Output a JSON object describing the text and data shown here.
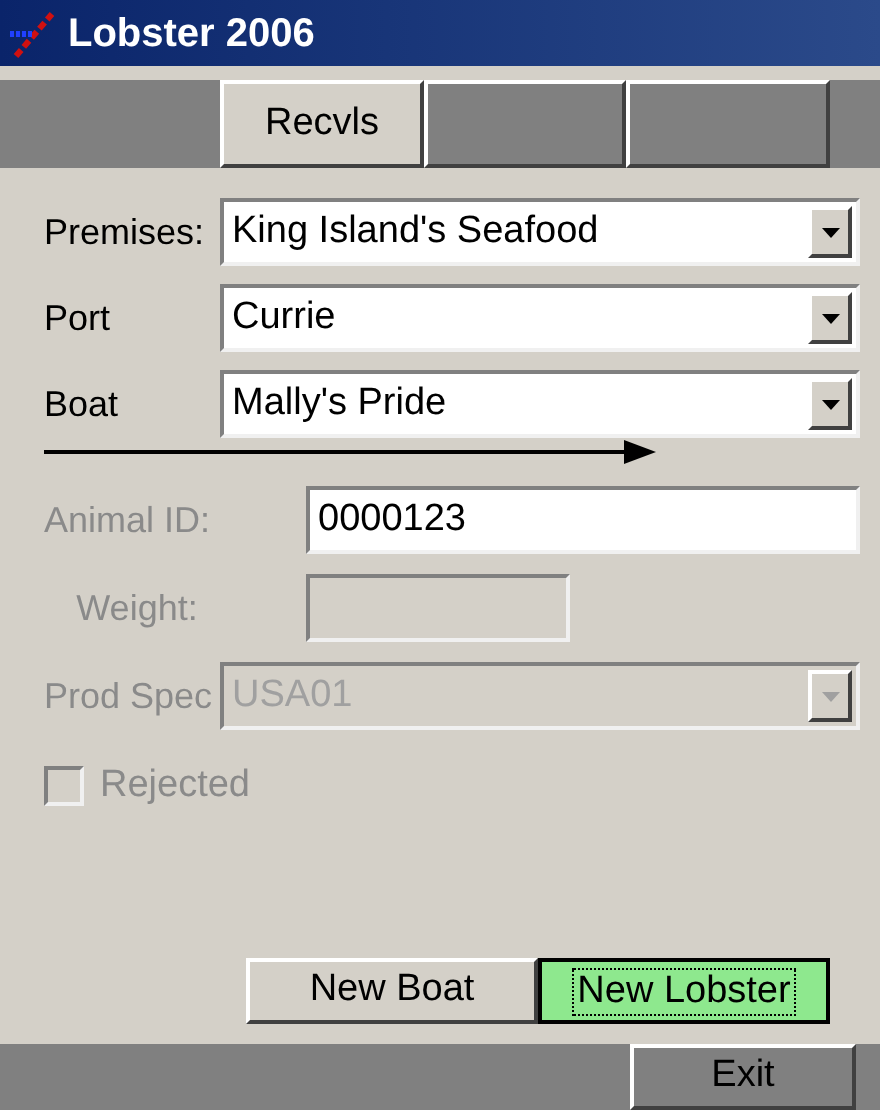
{
  "window": {
    "title": "Lobster 2006"
  },
  "tabs": [
    {
      "label": "Recvls",
      "selected": true
    }
  ],
  "fields": [
    {
      "label": "Premises:",
      "kind": "select",
      "value": "King Island's Seafood",
      "disabled": false,
      "label_disabled": false
    },
    {
      "label": "Port",
      "kind": "select",
      "value": "Currie",
      "disabled": false,
      "label_disabled": false
    },
    {
      "label": "Boat",
      "kind": "select",
      "value": "Mally's Pride",
      "disabled": false,
      "label_disabled": false
    },
    {
      "label": "Animal ID:",
      "kind": "text",
      "value": "0000123",
      "disabled": false,
      "label_disabled": true
    },
    {
      "label": "Weight:",
      "kind": "short",
      "disabled": true,
      "label_disabled": true
    },
    {
      "label": "Prod Spec",
      "kind": "select",
      "value": "USA01",
      "disabled": true,
      "label_disabled": true
    }
  ],
  "rejected": {
    "label": "Rejected",
    "checked": false,
    "disabled": true
  },
  "buttons": [
    {
      "label": "New Boat",
      "default": false
    },
    {
      "label": "New Lobster",
      "default": true
    }
  ],
  "exit": {
    "label": "Exit"
  }
}
